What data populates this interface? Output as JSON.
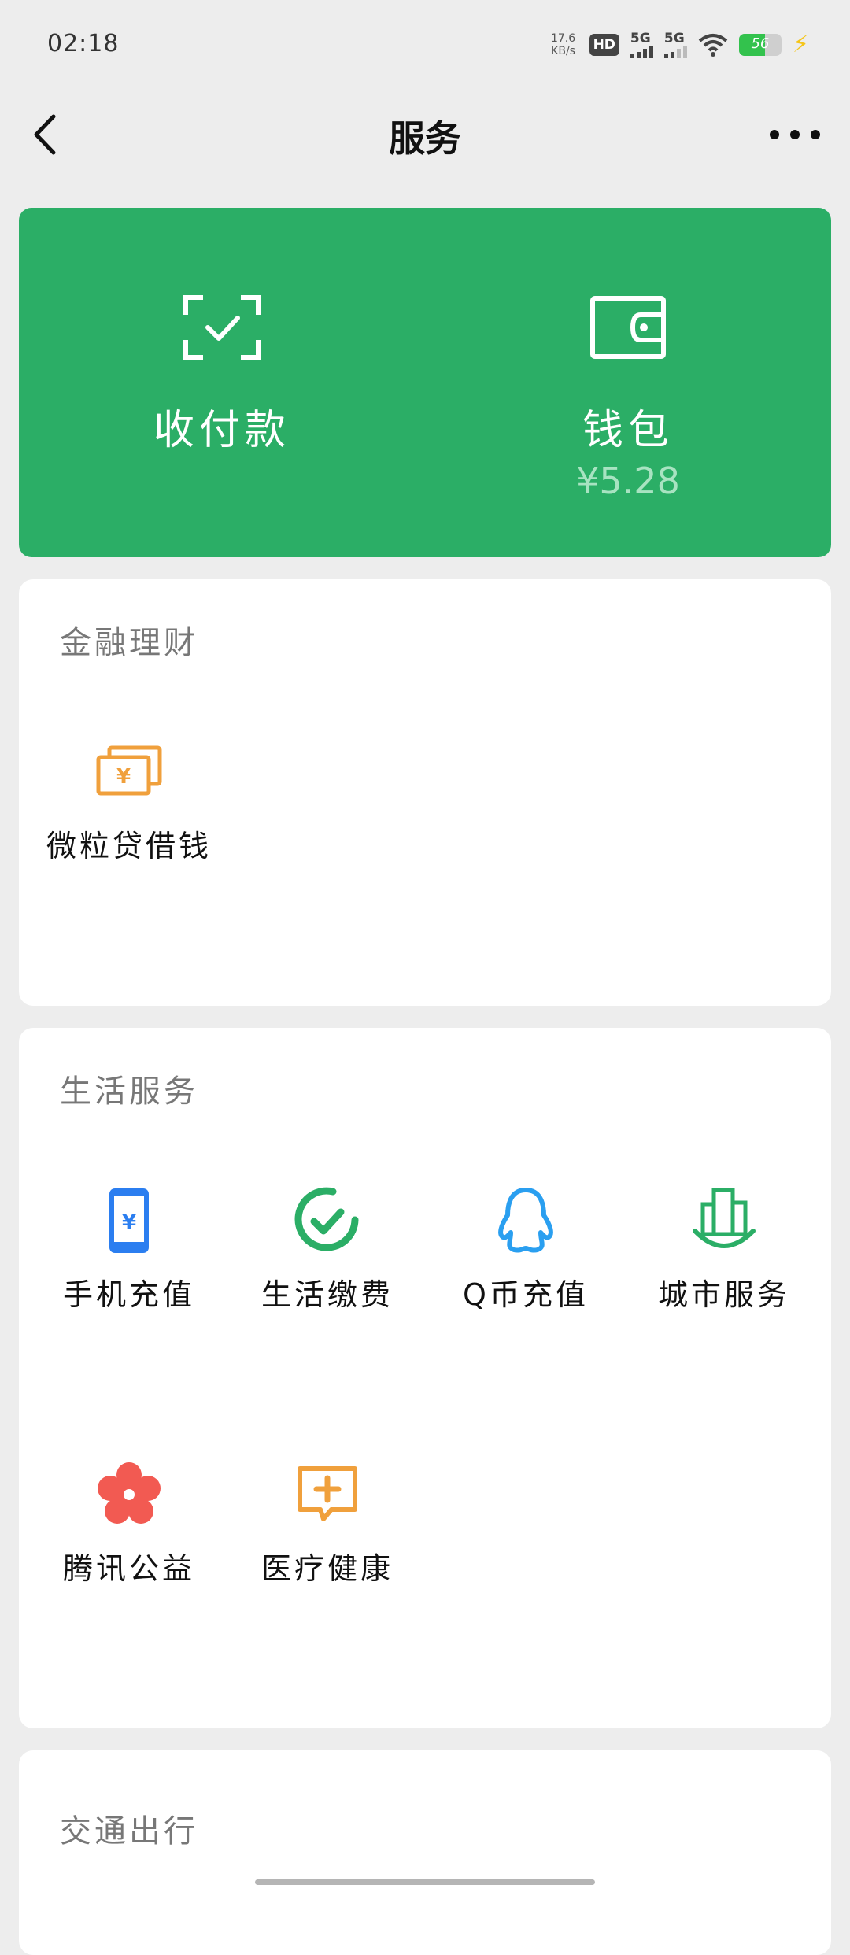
{
  "status": {
    "time": "02:18",
    "net_speed": "17.6",
    "net_unit": "KB/s",
    "hd": "HD",
    "sim1": "5G",
    "sim2": "5G",
    "battery": "56"
  },
  "nav": {
    "title": "服务",
    "back_icon": "chevron-left-icon",
    "more_icon": "more-horizontal-icon"
  },
  "hero": {
    "pay": {
      "label": "收付款",
      "icon": "scan-check-icon"
    },
    "wallet": {
      "label": "钱包",
      "balance": "¥5.28",
      "icon": "wallet-icon"
    }
  },
  "finance": {
    "title": "金融理财",
    "items": [
      {
        "label": "微粒贷借钱",
        "icon": "yuan-cards-icon",
        "color": "#f0a03c"
      }
    ]
  },
  "life": {
    "title": "生活服务",
    "items": [
      {
        "label": "手机充值",
        "icon": "phone-yuan-icon",
        "color": "#2b7ef0"
      },
      {
        "label": "生活缴费",
        "icon": "check-circle-icon",
        "color": "#2bae66"
      },
      {
        "label": "Q币充值",
        "icon": "penguin-icon",
        "color": "#2a9ff0"
      },
      {
        "label": "城市服务",
        "icon": "city-icon",
        "color": "#2bae66"
      },
      {
        "label": "腾讯公益",
        "icon": "flower-icon",
        "color": "#f25a52"
      },
      {
        "label": "医疗健康",
        "icon": "medical-chat-icon",
        "color": "#f0a03c"
      }
    ]
  },
  "transport": {
    "title": "交通出行"
  },
  "colors": {
    "brand_green": "#2bae66",
    "background": "#ededed"
  }
}
